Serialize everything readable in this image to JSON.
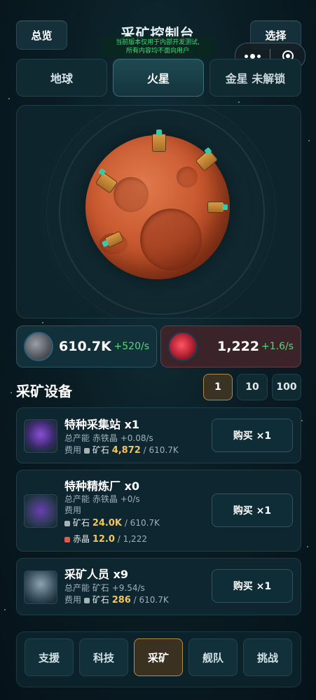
{
  "header": {
    "title": "采矿控制台",
    "overview_label": "总览",
    "select_label": "选择",
    "notice_line1": "当前版本仅用于内部开发测试,",
    "notice_line2": "所有内容均不面向用户"
  },
  "planet_tabs": [
    {
      "label": "地球",
      "active": false
    },
    {
      "label": "火星",
      "active": true
    },
    {
      "label": "金星 未解锁",
      "active": false
    }
  ],
  "resources": {
    "ore": {
      "icon": "ore-icon",
      "value": "610.7K",
      "rate": "+520/s"
    },
    "crystal": {
      "icon": "red-crystal-icon",
      "value": "1,222",
      "rate": "+1.6/s"
    }
  },
  "equipment_section": {
    "title": "采矿设备",
    "quantities": [
      "1",
      "10",
      "100"
    ],
    "selected_quantity": "1"
  },
  "equipment": [
    {
      "name": "特种采集站 x1",
      "output_label": "总产能",
      "output_res": "赤铁晶",
      "output_rate": "+0.08/s",
      "cost_label": "费用",
      "costs": [
        {
          "res": "矿石",
          "amount": "4,872",
          "have": "/ 610.7K"
        }
      ],
      "buy_label": "购买 ×1",
      "icon": "purple-crystal-station-icon"
    },
    {
      "name": "特种精炼厂 x0",
      "output_label": "总产能",
      "output_res": "赤铁晶",
      "output_rate": "+0/s",
      "cost_label": "费用",
      "costs": [
        {
          "res": "矿石",
          "amount": "24.0K",
          "have": "/ 610.7K"
        },
        {
          "res": "赤晶",
          "amount": "12.0",
          "have": "/ 1,222"
        }
      ],
      "buy_label": "购买 ×1",
      "icon": "refinery-icon"
    },
    {
      "name": "采矿人员 x9",
      "output_label": "总产能",
      "output_res": "矿石",
      "output_rate": "+9.54/s",
      "cost_label": "费用",
      "costs": [
        {
          "res": "矿石",
          "amount": "286",
          "have": "/ 610.7K"
        }
      ],
      "buy_label": "购买 ×1",
      "icon": "miner-icon"
    }
  ],
  "bottom_nav": [
    {
      "label": "支援",
      "active": false
    },
    {
      "label": "科技",
      "active": false
    },
    {
      "label": "采矿",
      "active": true
    },
    {
      "label": "舰队",
      "active": false
    },
    {
      "label": "挑战",
      "active": false
    }
  ],
  "colors": {
    "accent_gold": "#b58c44",
    "rate_green": "#5ad67c",
    "cost_yellow": "#f2c65a"
  }
}
